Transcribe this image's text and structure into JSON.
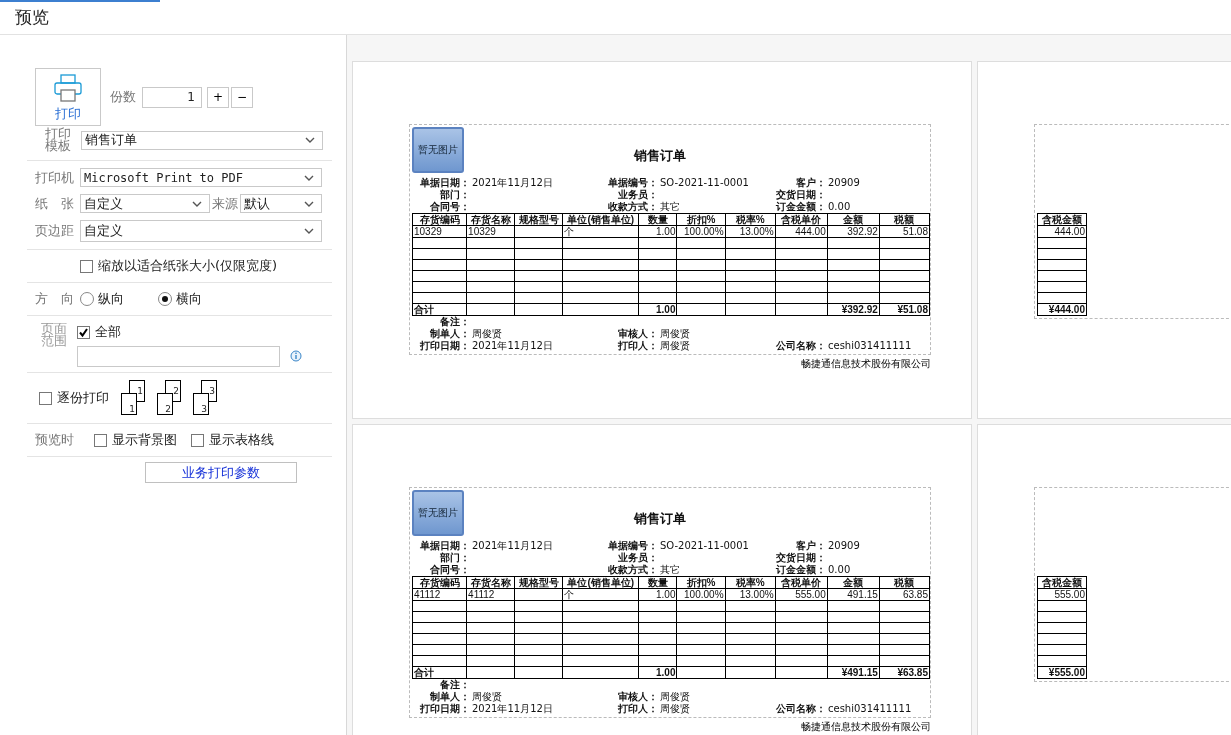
{
  "window": {
    "title": "预览"
  },
  "print_button": {
    "label": "打印"
  },
  "copies": {
    "label": "份数",
    "value": "1",
    "plus": "+",
    "minus": "−"
  },
  "template": {
    "label": "打印模板",
    "value": "销售订单"
  },
  "printer": {
    "label": "打印机",
    "value": "Microsoft Print to PDF"
  },
  "paper": {
    "label": "纸　张",
    "value": "自定义",
    "source_label": "来源",
    "source_value": "默认"
  },
  "margins": {
    "label": "页边距",
    "value": "自定义"
  },
  "fit_to_paper": {
    "label": "缩放以适合纸张大小(仅限宽度)",
    "checked": false
  },
  "orientation": {
    "label": "方　向",
    "options": [
      {
        "label": "纵向",
        "selected": false
      },
      {
        "label": "横向",
        "selected": true
      }
    ]
  },
  "page_range": {
    "label": "页面范围",
    "all": {
      "label": "全部",
      "checked": true
    }
  },
  "collate": {
    "label": "逐份打印",
    "checked": false,
    "icon_labels": [
      {
        "back": "1",
        "front": "1"
      },
      {
        "back": "2",
        "front": "2"
      },
      {
        "back": "3",
        "front": "3"
      }
    ]
  },
  "preview_options": {
    "label": "预览时",
    "options": [
      {
        "label": "显示背景图",
        "checked": false
      },
      {
        "label": "显示表格线",
        "checked": false
      }
    ]
  },
  "business_params_button": {
    "label": "业务打印参数"
  },
  "pages": [
    {
      "kind": "main",
      "image_placeholder": "暂无图片",
      "title": "销售订单",
      "info_rows": [
        [
          {
            "label": "单据日期：",
            "value": "2021年11月12日"
          },
          {
            "label": "单据编号：",
            "value": "SO-2021-11-0001"
          },
          {
            "label": "客户：",
            "value": "20909"
          }
        ],
        [
          {
            "label": "部门："
          },
          {
            "label": "业务员："
          },
          {
            "label": "交货日期："
          }
        ],
        [
          {
            "label": "合同号："
          },
          {
            "label": "收款方式：",
            "value": "其它"
          },
          {
            "label": "订金金额：",
            "value": "0.00"
          }
        ]
      ],
      "columns": [
        "存货编码",
        "存货名称",
        "规格型号",
        "单位(销售单位)",
        "数量",
        "折扣%",
        "税率%",
        "含税单价",
        "金额",
        "税额"
      ],
      "rows": [
        {
          "code": "10329",
          "name": "10329",
          "unit": "个",
          "quantity": "1.00",
          "discount": "100.00%",
          "tax_rate": "13.00%",
          "unit_price": "444.00",
          "amount": "392.92",
          "tax": "51.08"
        }
      ],
      "total": {
        "label": "合计",
        "quantity": "1.00",
        "amount": "¥392.92",
        "tax": "¥51.08"
      },
      "footer_rows": [
        [
          {
            "label": "备注："
          }
        ],
        [
          {
            "label": "制单人：",
            "value": "周俊贤"
          },
          {
            "label": "审核人：",
            "value": "周俊贤"
          }
        ],
        [
          {
            "label": "打印日期：",
            "value": "2021年11月12日"
          },
          {
            "label": "打印人：",
            "value": "周俊贤"
          },
          {
            "label": "公司名称：",
            "value": "ceshi031411111"
          }
        ]
      ],
      "company": "畅捷通信息技术股份有限公司"
    },
    {
      "kind": "overflow",
      "columns": [
        "含税金额"
      ],
      "rows": [
        {
          "total_with_tax": "444.00"
        }
      ],
      "total": {
        "total_with_tax": "¥444.00"
      }
    },
    {
      "kind": "main",
      "image_placeholder": "暂无图片",
      "title": "销售订单",
      "info_rows": [
        [
          {
            "label": "单据日期：",
            "value": "2021年11月12日"
          },
          {
            "label": "单据编号：",
            "value": "SO-2021-11-0001"
          },
          {
            "label": "客户：",
            "value": "20909"
          }
        ],
        [
          {
            "label": "部门："
          },
          {
            "label": "业务员："
          },
          {
            "label": "交货日期："
          }
        ],
        [
          {
            "label": "合同号："
          },
          {
            "label": "收款方式：",
            "value": "其它"
          },
          {
            "label": "订金金额：",
            "value": "0.00"
          }
        ]
      ],
      "columns": [
        "存货编码",
        "存货名称",
        "规格型号",
        "单位(销售单位)",
        "数量",
        "折扣%",
        "税率%",
        "含税单价",
        "金额",
        "税额"
      ],
      "rows": [
        {
          "code": "41112",
          "name": "41112",
          "unit": "个",
          "quantity": "1.00",
          "discount": "100.00%",
          "tax_rate": "13.00%",
          "unit_price": "555.00",
          "amount": "491.15",
          "tax": "63.85"
        }
      ],
      "total": {
        "label": "合计",
        "quantity": "1.00",
        "amount": "¥491.15",
        "tax": "¥63.85"
      },
      "footer_rows": [
        [
          {
            "label": "备注："
          }
        ],
        [
          {
            "label": "制单人：",
            "value": "周俊贤"
          },
          {
            "label": "审核人：",
            "value": "周俊贤"
          }
        ],
        [
          {
            "label": "打印日期：",
            "value": "2021年11月12日"
          },
          {
            "label": "打印人：",
            "value": "周俊贤"
          },
          {
            "label": "公司名称：",
            "value": "ceshi031411111"
          }
        ]
      ],
      "company": "畅捷通信息技术股份有限公司"
    },
    {
      "kind": "overflow",
      "columns": [
        "含税金额"
      ],
      "rows": [
        {
          "total_with_tax": "555.00"
        }
      ],
      "total": {
        "total_with_tax": "¥555.00"
      }
    }
  ]
}
